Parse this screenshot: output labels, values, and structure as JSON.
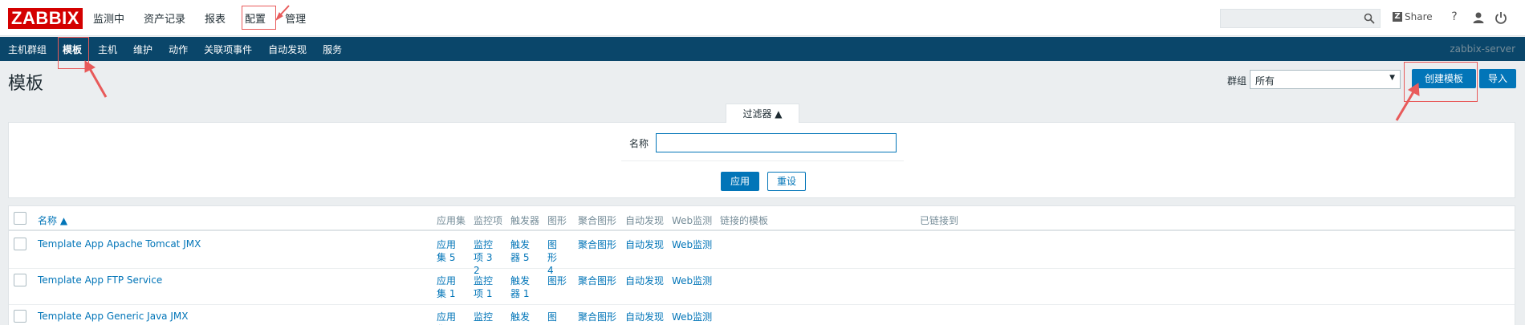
{
  "header": {
    "logo": "ZABBIX",
    "nav": [
      "监测中",
      "资产记录",
      "报表",
      "配置",
      "管理"
    ],
    "active_nav": "配置",
    "share_label": "Share",
    "help_label": "?",
    "colors": {
      "logo": "#d40000",
      "subnav": "#0a466a",
      "accent": "#0275b8",
      "annotation": "#e85a5a"
    }
  },
  "subnav": {
    "items": [
      "主机群组",
      "模板",
      "主机",
      "维护",
      "动作",
      "关联项事件",
      "自动发现",
      "服务"
    ],
    "active": "模板",
    "server": "zabbix-server"
  },
  "page": {
    "title": "模板",
    "group_label": "群组",
    "group_value": "所有",
    "create_label": "创建模板",
    "import_label": "导入"
  },
  "filter": {
    "tab_label": "过滤器 ▲",
    "name_label": "名称",
    "name_value": "",
    "apply_label": "应用",
    "reset_label": "重设"
  },
  "table": {
    "columns": {
      "name": "名称 ▲",
      "apps": "应用集",
      "items": "监控项",
      "triggers": "触发器",
      "graphs": "图形",
      "screens": "聚合图形",
      "discovery": "自动发现",
      "web": "Web监测",
      "linked_templates": "链接的模板",
      "linked_to": "已链接到"
    },
    "rows": [
      {
        "name": "Template App Apache Tomcat JMX",
        "apps": "应用集 5",
        "items": "监控项 32",
        "triggers": "触发器 5",
        "graphs": "图形 4",
        "screens": "聚合图形",
        "discovery": "自动发现",
        "web": "Web监测"
      },
      {
        "name": "Template App FTP Service",
        "apps": "应用集 1",
        "items": "监控项 1",
        "triggers": "触发器 1",
        "graphs": "图形",
        "screens": "聚合图形",
        "discovery": "自动发现",
        "web": "Web监测"
      },
      {
        "name": "Template App Generic Java JMX",
        "apps": "应用集",
        "items": "监控项",
        "triggers": "触发器",
        "graphs": "图",
        "screens": "聚合图形",
        "discovery": "自动发现",
        "web": "Web监测"
      }
    ]
  }
}
